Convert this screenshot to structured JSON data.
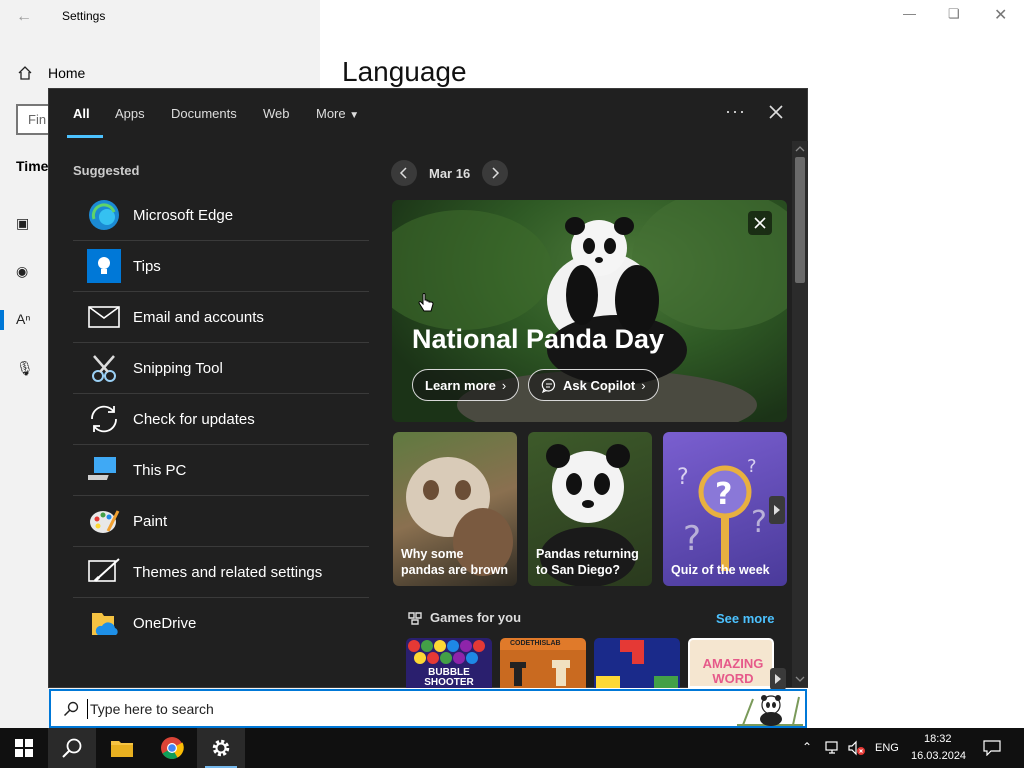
{
  "settings": {
    "title": "Settings",
    "home_label": "Home",
    "find_placeholder": "Fin",
    "section_heading": "Time",
    "page_heading": "Language"
  },
  "search": {
    "tabs": [
      "All",
      "Apps",
      "Documents",
      "Web",
      "More"
    ],
    "suggested_heading": "Suggested",
    "apps": [
      {
        "label": "Microsoft Edge",
        "icon": "edge-icon"
      },
      {
        "label": "Tips",
        "icon": "tips-icon"
      },
      {
        "label": "Email and accounts",
        "icon": "mail-icon"
      },
      {
        "label": "Snipping Tool",
        "icon": "snipping-tool-icon"
      },
      {
        "label": "Check for updates",
        "icon": "update-icon"
      },
      {
        "label": "This PC",
        "icon": "this-pc-icon"
      },
      {
        "label": "Paint",
        "icon": "paint-icon"
      },
      {
        "label": "Themes and related settings",
        "icon": "themes-icon"
      },
      {
        "label": "OneDrive",
        "icon": "onedrive-icon"
      }
    ],
    "date_label": "Mar 16",
    "hero": {
      "title": "National Panda Day",
      "learn_more": "Learn more",
      "ask_copilot": "Ask Copilot"
    },
    "cards": [
      {
        "line1": "Why some",
        "line2": "pandas are brown"
      },
      {
        "line1": "Pandas returning",
        "line2": "to San Diego?"
      },
      {
        "line1": "Quiz of the week",
        "line2": ""
      }
    ],
    "games_heading": "Games for you",
    "see_more": "See more",
    "games": [
      {
        "name": "Bubble Shooter",
        "text": "BUBBLE SHOOTER"
      },
      {
        "name": "Chess",
        "text": "CODETHISLAB"
      },
      {
        "name": "Block puzzle",
        "text": ""
      },
      {
        "name": "Amazing Word",
        "text": "AMAZING WORD"
      }
    ],
    "placeholder": "Type here to search"
  },
  "taskbar": {
    "language": "ENG",
    "time": "18:32",
    "date": "16.03.2024"
  },
  "colors": {
    "accent": "#0078d7",
    "link": "#4cc2ff",
    "panel_bg": "#202020",
    "taskbar_bg": "#101010"
  }
}
